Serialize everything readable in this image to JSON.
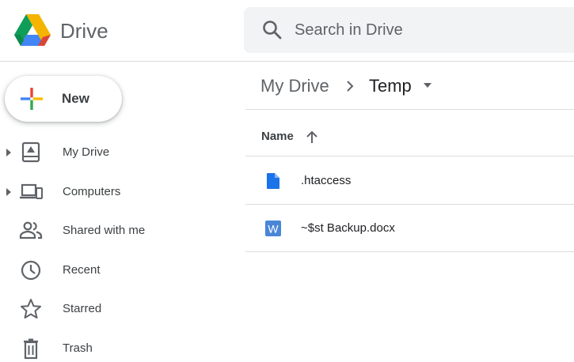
{
  "header": {
    "product_name": "Drive",
    "logo_icon": "google-drive-logo",
    "search": {
      "placeholder": "Search in Drive",
      "value": "",
      "icon": "search-icon"
    }
  },
  "sidebar": {
    "new_button": {
      "label": "New",
      "icon": "plus-icon"
    },
    "items": [
      {
        "label": "My Drive",
        "icon": "my-drive-icon",
        "expandable": true
      },
      {
        "label": "Computers",
        "icon": "computers-icon",
        "expandable": true
      },
      {
        "label": "Shared with me",
        "icon": "people-icon",
        "expandable": false
      },
      {
        "label": "Recent",
        "icon": "clock-icon",
        "expandable": false
      },
      {
        "label": "Starred",
        "icon": "star-icon",
        "expandable": false
      },
      {
        "label": "Trash",
        "icon": "trash-icon",
        "expandable": false
      }
    ]
  },
  "main": {
    "breadcrumb": {
      "root": "My Drive",
      "current": "Temp"
    },
    "columns": {
      "name": "Name",
      "sort": "ascending"
    },
    "files": [
      {
        "name": ".htaccess",
        "icon": "document-file-icon"
      },
      {
        "name": "~$st Backup.docx",
        "icon": "word-file-icon"
      }
    ]
  },
  "colors": {
    "accent_blue": "#1a73e8",
    "word_blue": "#4a86d8",
    "icon_gray": "#5f6368",
    "border": "#dadce0",
    "search_bg": "#f1f3f4",
    "logo_green": "#0f9d58",
    "logo_yellow": "#f4b400",
    "logo_blue": "#4285f4",
    "logo_red": "#db4437"
  }
}
